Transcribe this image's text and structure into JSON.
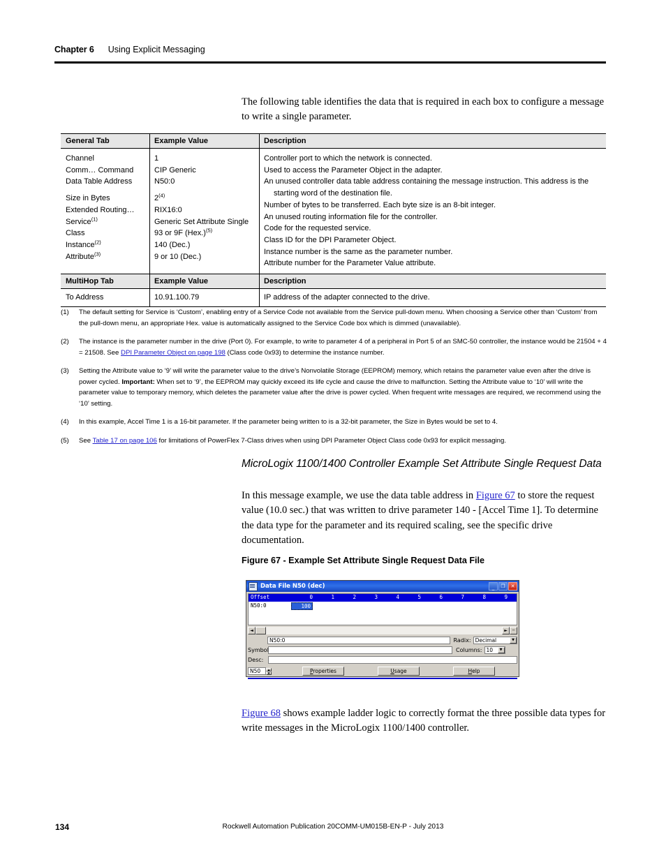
{
  "header": {
    "chapter": "Chapter 6",
    "title": "Using Explicit Messaging"
  },
  "intro_paragraph": "The following table identifies the data that is required in each box to configure a message to write a single parameter.",
  "table": {
    "general_headers": [
      "General Tab",
      "Example Value",
      "Description"
    ],
    "general_rows": [
      {
        "field": "Channel",
        "value": "1",
        "desc": "Controller port to which the network is connected."
      },
      {
        "field": "Comm… Command",
        "value": "CIP Generic",
        "desc": "Used to access the Parameter Object in the adapter."
      },
      {
        "field": "Data Table Address",
        "value": "N50:0",
        "desc": "An unused controller data table address containing the message instruction. This address is the",
        "desc2": "starting word of the destination file."
      },
      {
        "field": "Size in Bytes",
        "value": "2",
        "value_sup": "(4)",
        "desc": "Number of bytes to be transferred. Each byte size is an 8-bit integer."
      },
      {
        "field": "Extended Routing…",
        "value": "RIX16:0",
        "desc": "An unused routing information file for the controller."
      },
      {
        "field": "Service",
        "field_sup": "(1)",
        "value": "Generic Set Attribute Single",
        "desc": "Code for the requested service."
      },
      {
        "field": "Class",
        "value": "93 or 9F (Hex.)",
        "value_sup": "(5)",
        "desc": "Class ID for the DPI Parameter Object."
      },
      {
        "field": "Instance",
        "field_sup": "(2)",
        "value": "140 (Dec.)",
        "desc": "Instance number is the same as the parameter number."
      },
      {
        "field": "Attribute",
        "field_sup": "(3)",
        "value": "9 or 10 (Dec.)",
        "desc": "Attribute number for the Parameter Value attribute."
      }
    ],
    "multihop_headers": [
      "MultiHop Tab",
      "Example Value",
      "Description"
    ],
    "multihop_rows": [
      {
        "field": "To Address",
        "value": "10.91.100.79",
        "desc": "IP address of the adapter connected to the drive."
      }
    ]
  },
  "footnotes": [
    {
      "num": "(1)",
      "text": "The default setting for Service is ‘Custom’, enabling entry of a Service Code not available from the Service pull-down menu. When choosing a Service other than ‘Custom’ from the pull-down menu, an appropriate Hex. value is automatically assigned to the Service Code box which is dimmed (unavailable)."
    },
    {
      "num": "(2)",
      "text_before": "The instance is the parameter number in the drive (Port 0). For example, to write to parameter 4 of a peripheral in Port 5 of an SMC-50 controller, the instance would be 21504 + 4 = 21508. See ",
      "link": "DPI Parameter Object on page 198",
      "text_after": " (Class code 0x93) to determine the instance number."
    },
    {
      "num": "(3)",
      "text_before": "Setting the Attribute value to ‘9’ will write the parameter value to the drive’s Nonvolatile Storage (EEPROM) memory, which retains the parameter value even after the drive is power cycled. ",
      "bold": "Important:",
      "text_after": " When set to ‘9’, the EEPROM may quickly exceed its life cycle and cause the drive to malfunction. Setting the Attribute value to ‘10’ will write the parameter value to temporary memory, which deletes the parameter value after the drive is power cycled. When frequent write messages are required, we recommend using the ‘10’ setting."
    },
    {
      "num": "(4)",
      "text": "In this example, Accel Time 1 is a 16-bit parameter. If the parameter being written to is a 32-bit parameter, the Size in Bytes would be set to 4."
    },
    {
      "num": "(5)",
      "text_before": "See ",
      "link": "Table 17 on page 106",
      "text_after": " for limitations of PowerFlex 7-Class drives when using DPI Parameter Object Class code 0x93 for explicit messaging."
    }
  ],
  "section": {
    "heading": "MicroLogix 1100/1400 Controller Example Set Attribute Single Request Data",
    "para_before": "In this message example, we use the data table address in ",
    "para_link": "Figure 67",
    "para_after": " to store the request value (10.0 sec.) that was written to drive parameter 140 - [Accel Time 1]. To determine the data type for the parameter and its required scaling, see the specific drive documentation."
  },
  "figure": {
    "caption": "Figure 67 - Example Set Attribute Single Request Data File",
    "window": {
      "title": "Data File N50 (dec)",
      "minimize_label": "_",
      "maximize_label": "❐",
      "close_label": "✕",
      "grid": {
        "offset_header": "Offset",
        "column_headers": [
          "0",
          "1",
          "2",
          "3",
          "4",
          "5",
          "6",
          "7",
          "8",
          "9"
        ],
        "row_label": "N50:0",
        "selected_value": "100"
      },
      "address_value": "N50:0",
      "radix_label": "Radix:",
      "radix_value": "Decimal",
      "symbol_label": "Symbol:",
      "symbol_value": "",
      "columns_label": "Columns:",
      "columns_value": "10",
      "desc_label": "Desc:",
      "desc_value": "",
      "file_spinner_value": "N50",
      "buttons": [
        {
          "pre": "",
          "accel": "P",
          "post": "roperties"
        },
        {
          "pre": "",
          "accel": "U",
          "post": "sage"
        },
        {
          "pre": "",
          "accel": "H",
          "post": "elp"
        }
      ]
    }
  },
  "closing": {
    "link": "Figure 68",
    "text_after": " shows example ladder logic to correctly format the three possible data types for write messages in the MicroLogix 1100/1400 controller."
  },
  "footer": {
    "page_number": "134",
    "publication": "Rockwell Automation Publication  20COMM-UM015B-EN-P - July 2013"
  }
}
